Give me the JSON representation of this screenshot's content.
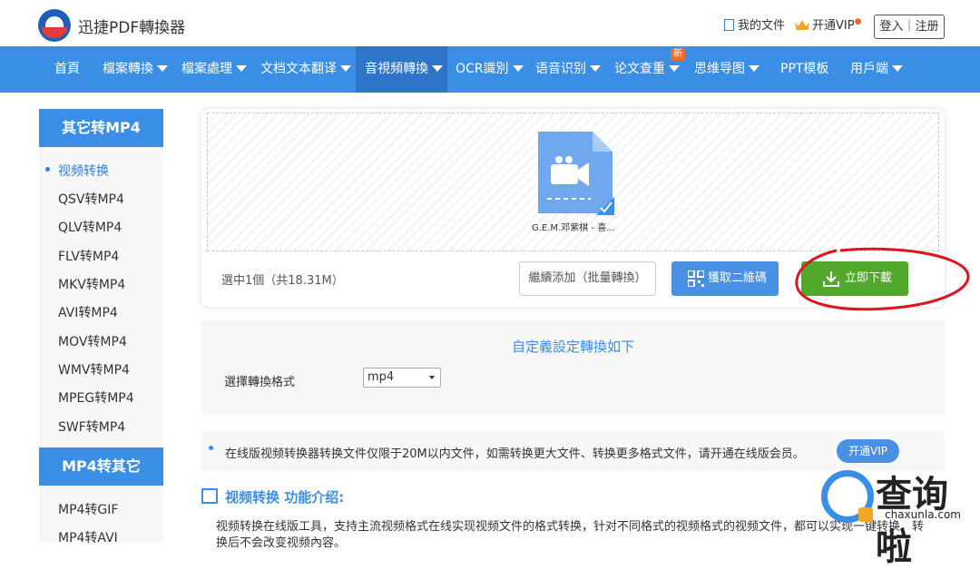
{
  "header": {
    "brand": "迅捷PDF轉換器",
    "my_files": "我的文件",
    "vip": "开通VIP",
    "login": "登入｜注册"
  },
  "nav": {
    "items": [
      "首頁",
      "檔案轉換",
      "檔案處理",
      "文档文本翻译",
      "音視頻轉換",
      "OCR識別",
      "语音识别",
      "论文查重",
      "思维导图",
      "PPT模板",
      "用戶端"
    ],
    "badge": "新"
  },
  "sidebar": {
    "head1": "其它转MP4",
    "items1": [
      "视频转换",
      "QSV转MP4",
      "QLV转MP4",
      "FLV转MP4",
      "MKV转MP4",
      "AVI转MP4",
      "MOV转MP4",
      "WMV转MP4",
      "MPEG转MP4",
      "SWF转MP4"
    ],
    "head2": "MP4转其它",
    "items2": [
      "MP4转GIF",
      "MP4转AVI"
    ]
  },
  "upload": {
    "file_name": "G.E.M.邓紫棋 - 喜...",
    "selection": "選中1個（共18.31M）",
    "add_more": "繼續添加（批量轉換）",
    "qr": "獲取二維碼",
    "download": "立即下載"
  },
  "settings": {
    "title": "自定義設定轉換如下",
    "format_label": "選擇轉換格式",
    "format_value": "mp4"
  },
  "notice": {
    "text": "在线版视频转换器转换文件仅限于20M以内文件，如需转换更大文件、转换更多格式文件，请开通在线版会员。",
    "vip_button": "开通VIP"
  },
  "intro": {
    "title": "视频转换 功能介绍:",
    "text": "视频转换在线版工具，支持主流视频格式在线实现视频文件的格式转换，针对不同格式的视频格式的视频文件，都可以实现一键转换，转换后不会改变视频內容。"
  },
  "watermark": {
    "text": "查询啦",
    "url": "chaxunla.com"
  },
  "colors": {
    "primary": "#3a8ee6",
    "download_green": "#52a82c",
    "annotation_red": "#e0141e"
  }
}
